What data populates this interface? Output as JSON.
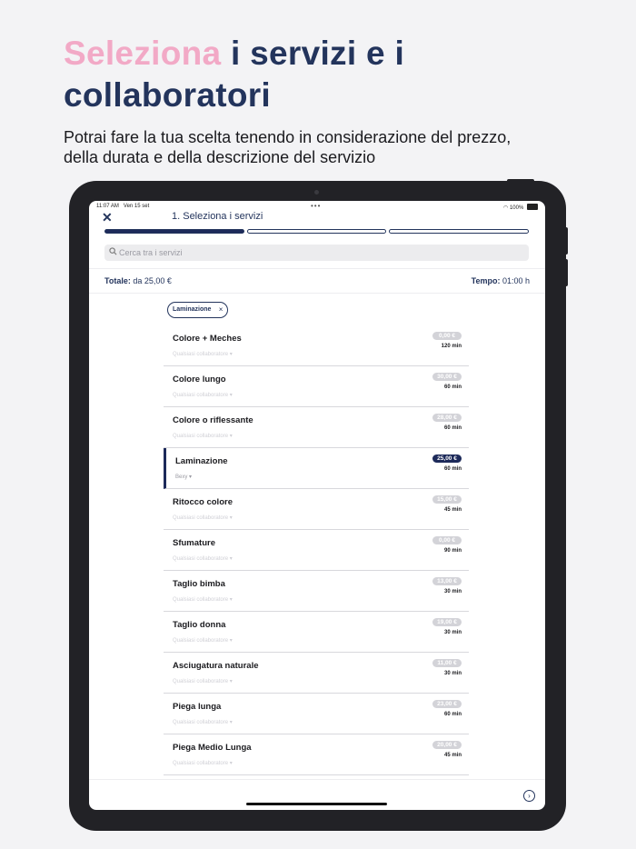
{
  "promo": {
    "title_accent": "Seleziona",
    "title_rest_1": "i servizi  e i",
    "title_rest_2": "collaboratori",
    "subtitle_1": "Potrai fare la tua scelta tenendo in considerazione del prezzo,",
    "subtitle_2": "della durata e della descrizione del servizio"
  },
  "status_bar": {
    "time": "11:07 AM",
    "date": "Ven 15 set",
    "battery": "100%"
  },
  "header": {
    "step_title": "1. Seleziona i servizi",
    "progress_steps": 3,
    "active_step": 1
  },
  "search": {
    "placeholder": "Cerca tra i servizi"
  },
  "totals": {
    "total_label": "Totale:",
    "total_value": "da 25,00 €",
    "time_label": "Tempo:",
    "time_value": "01:00 h"
  },
  "filter_chip": {
    "label": "Laminazione",
    "remove": "×"
  },
  "services": [
    {
      "name": "Colore + Meches",
      "staff": "Qualsiasi collaboratore",
      "price": "0,00 €",
      "duration": "120 min",
      "selected": false
    },
    {
      "name": "Colore lungo",
      "staff": "Qualsiasi collaboratore",
      "price": "30,00 €",
      "duration": "60 min",
      "selected": false
    },
    {
      "name": "Colore o riflessante",
      "staff": "Qualsiasi collaboratore",
      "price": "28,00 €",
      "duration": "60 min",
      "selected": false
    },
    {
      "name": "Laminazione",
      "staff": "Bexy",
      "price": "25,00 €",
      "duration": "60 min",
      "selected": true
    },
    {
      "name": "Ritocco colore",
      "staff": "Qualsiasi collaboratore",
      "price": "15,00 €",
      "duration": "45 min",
      "selected": false
    },
    {
      "name": "Sfumature",
      "staff": "Qualsiasi collaboratore",
      "price": "0,00 €",
      "duration": "90 min",
      "selected": false
    },
    {
      "name": "Taglio bimba",
      "staff": "Qualsiasi collaboratore",
      "price": "13,00 €",
      "duration": "30 min",
      "selected": false
    },
    {
      "name": "Taglio donna",
      "staff": "Qualsiasi collaboratore",
      "price": "19,00 €",
      "duration": "30 min",
      "selected": false
    },
    {
      "name": "Asciugatura naturale",
      "staff": "Qualsiasi collaboratore",
      "price": "11,00 €",
      "duration": "30 min",
      "selected": false
    },
    {
      "name": "Piega lunga",
      "staff": "Qualsiasi collaboratore",
      "price": "23,00 €",
      "duration": "60 min",
      "selected": false
    },
    {
      "name": "Piega Medio Lunga",
      "staff": "Qualsiasi collaboratore",
      "price": "20,00 €",
      "duration": "45 min",
      "selected": false
    }
  ],
  "colors": {
    "primary": "#1d2a5a",
    "accent_pink": "#f2a9c6",
    "price_badge": "#d3d3d8"
  },
  "icons": {
    "close": "close-icon",
    "search": "search-icon",
    "next": "chevron-right-circle-icon",
    "dropdown": "caret-down-icon"
  }
}
